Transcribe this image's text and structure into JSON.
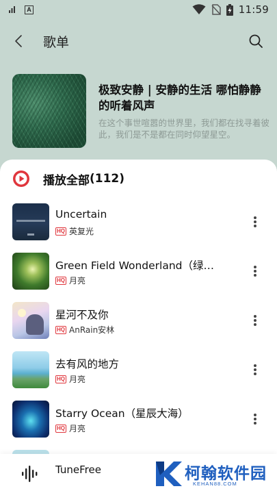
{
  "status_bar": {
    "time": "11:59",
    "icons": [
      "signal-bars-icon",
      "a-notification-icon",
      "wifi-icon",
      "no-sim-icon",
      "battery-charging-icon"
    ]
  },
  "header": {
    "title": "歌单",
    "back_icon": "chevron-left-icon",
    "search_icon": "search-icon"
  },
  "playlist": {
    "title": "极致安静 | 安静的生活 哪怕静静的听着风声",
    "description": "在这个事世喧嚣的世界里，我们都在找寻着彼此，我们是不是都在同时仰望星空。"
  },
  "play_all": {
    "label": "播放全部",
    "count": "(112)",
    "icon": "play-circle-icon"
  },
  "songs": [
    {
      "name": "Uncertain",
      "quality": "HQ",
      "artist": "英复光"
    },
    {
      "name": "Green Field Wonderland（绿野…",
      "quality": "HQ",
      "artist": "月亮"
    },
    {
      "name": "星河不及你",
      "quality": "HQ",
      "artist": "AnRain安林"
    },
    {
      "name": "去有风的地方",
      "quality": "HQ",
      "artist": "月亮"
    },
    {
      "name": "Starry Ocean（星辰大海）",
      "quality": "HQ",
      "artist": "月亮"
    }
  ],
  "mini_player": {
    "title": "TuneFree",
    "icon": "sound-wave-icon"
  },
  "watermark": {
    "text": "柯翰软件园",
    "sub": "KEHAN88.COM"
  },
  "colors": {
    "header_bg": "#c6d7d0",
    "accent_red": "#e0363d",
    "watermark_blue": "#1f5fbf"
  }
}
